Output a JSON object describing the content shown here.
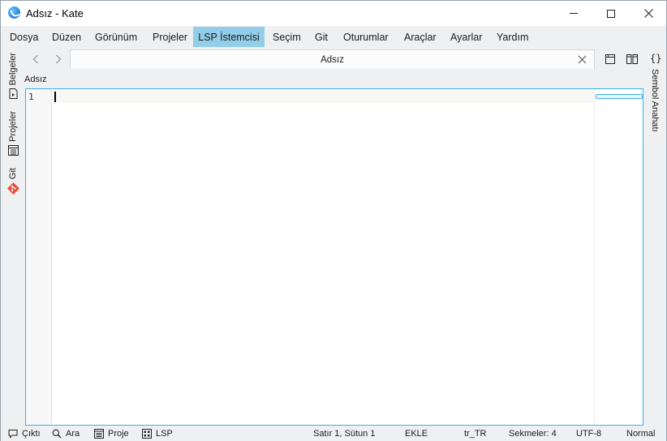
{
  "window": {
    "title": "Adsız  - Kate"
  },
  "menu": {
    "items": [
      {
        "label": "Dosya"
      },
      {
        "label": "Düzen"
      },
      {
        "label": "Görünüm"
      },
      {
        "label": "Projeler"
      },
      {
        "label": "LSP İstemcisi"
      },
      {
        "label": "Seçim"
      },
      {
        "label": "Git"
      },
      {
        "label": "Oturumlar"
      },
      {
        "label": "Araçlar"
      },
      {
        "label": "Ayarlar"
      },
      {
        "label": "Yardım"
      }
    ],
    "active_index": 4
  },
  "left_sidebar": {
    "tabs": [
      {
        "label": "Belgeler",
        "icon": "documents-icon"
      },
      {
        "label": "Projeler",
        "icon": "projects-icon"
      },
      {
        "label": "Git",
        "icon": "git-icon"
      }
    ]
  },
  "right_sidebar": {
    "tabs": [
      {
        "label": "Sembol Anahatı",
        "icon": "braces-icon"
      }
    ]
  },
  "tabs": {
    "items": [
      {
        "label": "Adsız"
      }
    ]
  },
  "breadcrumb": {
    "text": "Adsız"
  },
  "editor": {
    "line_numbers": [
      "1"
    ]
  },
  "statusbar": {
    "output": "Çıktı",
    "search": "Ara",
    "project": "Proje",
    "lsp": "LSP",
    "cursor_position": "Satır 1, Sütun 1",
    "input_mode": "EKLE",
    "dictionary": "tr_TR",
    "indent": "Sekmeler: 4",
    "encoding": "UTF-8",
    "mode": "Normal"
  },
  "colors": {
    "accent": "#3daee9",
    "menu_highlight": "#93cee9",
    "git_icon": "#e8503a"
  }
}
